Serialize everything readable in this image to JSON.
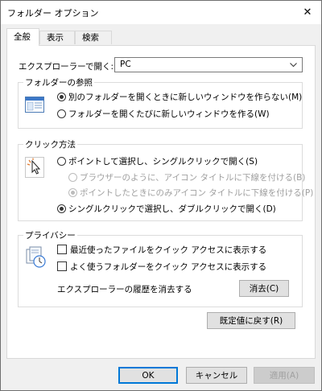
{
  "window": {
    "title": "フォルダー オプション",
    "close_symbol": "✕"
  },
  "tabs": [
    {
      "label": "全般",
      "active": true
    },
    {
      "label": "表示",
      "active": false
    },
    {
      "label": "検索",
      "active": false
    }
  ],
  "open_explorer": {
    "label": "エクスプローラーで開く:",
    "value": "PC"
  },
  "browse_folders": {
    "title": "フォルダーの参照",
    "options": [
      {
        "label": "別のフォルダーを開くときに新しいウィンドウを作らない(M)",
        "checked": true
      },
      {
        "label": "フォルダーを開くたびに新しいウィンドウを作る(W)",
        "checked": false
      }
    ]
  },
  "click_method": {
    "title": "クリック方法",
    "single_click": "ポイントして選択し、シングルクリックで開く(S)",
    "sub_options": [
      {
        "label": "ブラウザーのように、アイコン タイトルに下線を付ける(B)",
        "checked": false
      },
      {
        "label": "ポイントしたときにのみアイコン タイトルに下線を付ける(P)",
        "checked": true
      }
    ],
    "double_click": "シングルクリックで選択し、ダブルクリックで開く(D)"
  },
  "privacy": {
    "title": "プライバシー",
    "checks": [
      {
        "label": "最近使ったファイルをクイック アクセスに表示する",
        "checked": false
      },
      {
        "label": "よく使うフォルダーをクイック アクセスに表示する",
        "checked": false
      }
    ],
    "clear_history_label": "エクスプローラーの履歴を消去する",
    "clear_button": "消去(C)"
  },
  "restore_defaults": "既定値に戻す(R)",
  "footer": {
    "ok": "OK",
    "cancel": "キャンセル",
    "apply": "適用(A)"
  }
}
